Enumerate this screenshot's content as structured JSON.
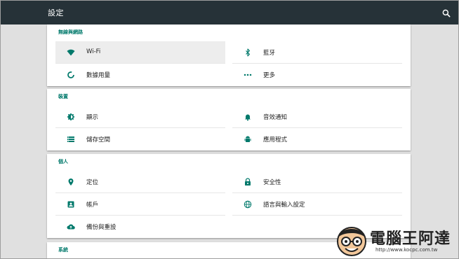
{
  "appbar": {
    "title": "設定",
    "search_icon": "search-icon"
  },
  "colors": {
    "appbar": "#263238",
    "accent": "#00796b",
    "background": "#e0e0e0",
    "selected": "#ededed"
  },
  "sections": [
    {
      "header": "無線與網路",
      "items": [
        {
          "label": "Wi-Fi",
          "icon": "wifi-icon",
          "selected": true
        },
        {
          "label": "藍牙",
          "icon": "bluetooth-icon"
        },
        {
          "label": "數據用量",
          "icon": "data-usage-icon"
        },
        {
          "label": "更多",
          "icon": "more-icon"
        }
      ]
    },
    {
      "header": "裝置",
      "items": [
        {
          "label": "顯示",
          "icon": "brightness-icon"
        },
        {
          "label": "音效通知",
          "icon": "bell-icon"
        },
        {
          "label": "儲存空間",
          "icon": "storage-icon"
        },
        {
          "label": "應用程式",
          "icon": "android-icon"
        }
      ]
    },
    {
      "header": "個人",
      "items": [
        {
          "label": "定位",
          "icon": "location-icon"
        },
        {
          "label": "安全性",
          "icon": "lock-icon"
        },
        {
          "label": "帳戶",
          "icon": "account-icon"
        },
        {
          "label": "語言與輸入設定",
          "icon": "language-icon"
        },
        {
          "label": "備份與重設",
          "icon": "cloud-upload-icon"
        }
      ]
    },
    {
      "header": "系統"
    }
  ],
  "watermark": {
    "brand": "電腦王阿達",
    "url": "http://www.kocpc.com.tw"
  }
}
